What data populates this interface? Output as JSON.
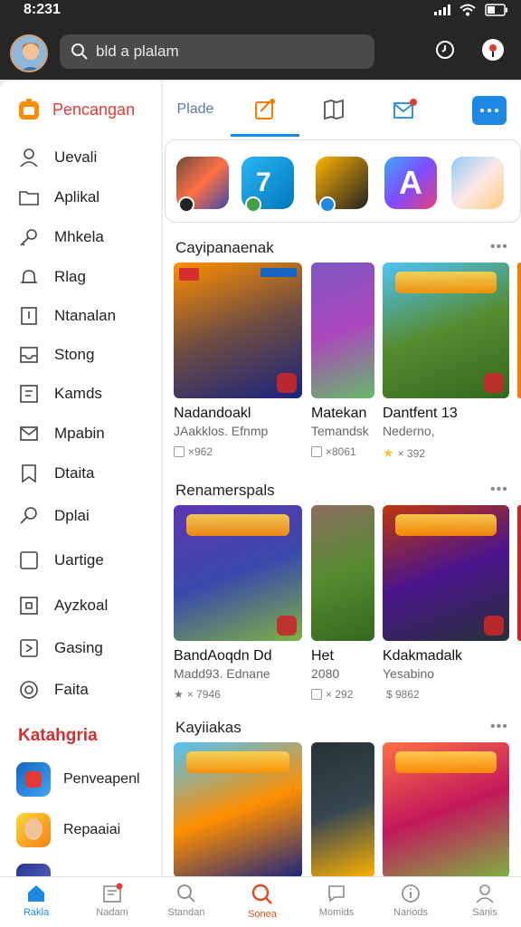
{
  "status_bar": {
    "time": "8:231"
  },
  "search": {
    "text": "bld a plalam"
  },
  "sidebar": {
    "header": "Pencangan",
    "items": [
      {
        "label": "Uevali",
        "icon": "person-icon"
      },
      {
        "label": "Aplikal",
        "icon": "folder-icon"
      },
      {
        "label": "Mhkela",
        "icon": "key-icon"
      },
      {
        "label": "Rlag",
        "icon": "bell-icon"
      },
      {
        "label": "Ntanalan",
        "icon": "book-icon"
      },
      {
        "label": "Stong",
        "icon": "inbox-icon"
      },
      {
        "label": "Kamds",
        "icon": "grid-icon"
      },
      {
        "label": "Mpabin",
        "icon": "mail-icon"
      },
      {
        "label": "Dtaita",
        "icon": "bookmark-icon"
      },
      {
        "label": "Dplai",
        "icon": "search-icon"
      },
      {
        "label": "Uartige",
        "icon": "square-icon"
      },
      {
        "label": "Ayzkoal",
        "icon": "frame-icon"
      },
      {
        "label": "Gasing",
        "icon": "compass-icon"
      },
      {
        "label": "Faita",
        "icon": "target-icon"
      }
    ],
    "category_title": "Katahgria",
    "categories": [
      {
        "label": "Penveapenl"
      },
      {
        "label": "Repaaiai"
      },
      {
        "label": ""
      }
    ]
  },
  "tabs": {
    "first_label": "Plade"
  },
  "sections": [
    {
      "title": "Cayipanaenak",
      "more": "•••",
      "cards": [
        {
          "name": "Nadandoakl",
          "sub": "JAakklos. Efnmp",
          "meta": "×962"
        },
        {
          "name": "Matekan",
          "sub": "Temandsk",
          "meta": "×8061"
        },
        {
          "name": "Dantfent 13",
          "sub": "Nederno,",
          "meta": "× 392"
        }
      ]
    },
    {
      "title": "Renamerspals",
      "more": "•••",
      "cards": [
        {
          "name": "BandAoqdn Dd",
          "sub": "Madd93. Ednane",
          "meta": "× 7946"
        },
        {
          "name": "Het",
          "sub": "2080",
          "meta": "× 292"
        },
        {
          "name": "Kdakmadalk",
          "sub": "Yesabino",
          "meta": "$ 9862"
        }
      ]
    },
    {
      "title": "Kayiiakas",
      "more": "•••",
      "cards": [
        {
          "name": "",
          "sub": "",
          "meta": ""
        },
        {
          "name": "",
          "sub": "",
          "meta": ""
        },
        {
          "name": "",
          "sub": "",
          "meta": ""
        }
      ]
    }
  ],
  "bottom_nav": [
    {
      "label": "Rakla",
      "icon": "home-icon"
    },
    {
      "label": "Nadam",
      "icon": "news-icon"
    },
    {
      "label": "Standan",
      "icon": "search-icon"
    },
    {
      "label": "Sonea",
      "icon": "discover-icon"
    },
    {
      "label": "Momids",
      "icon": "chat-icon"
    },
    {
      "label": "Nariods",
      "icon": "info-icon"
    },
    {
      "label": "Sanis",
      "icon": "profile-icon"
    }
  ],
  "colors": {
    "accent": "#1e88e5",
    "brand_red": "#e53935",
    "topbar": "#262626"
  }
}
